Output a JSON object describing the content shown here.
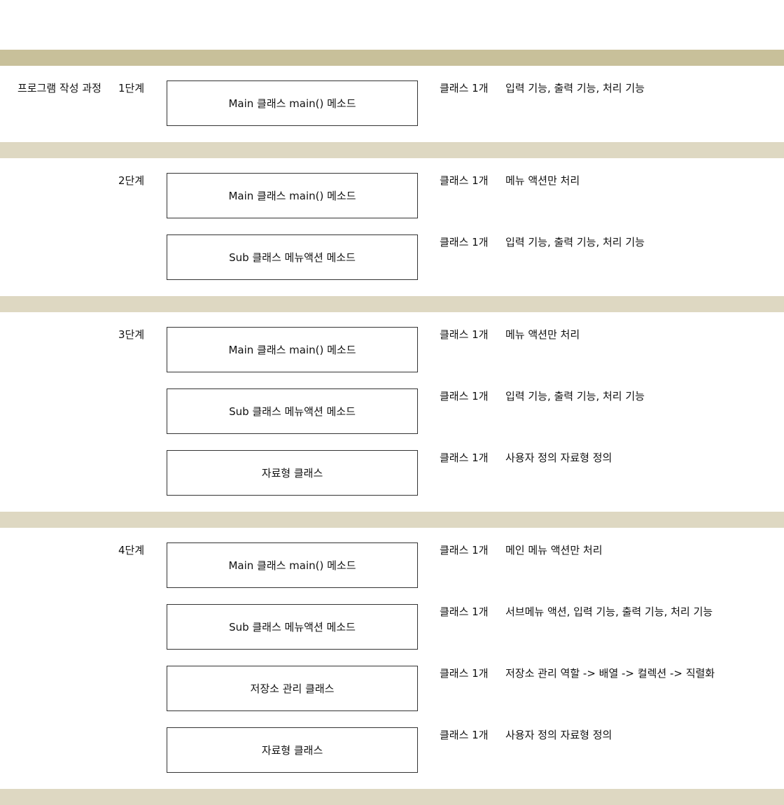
{
  "intro_label": "프로그램 작성 과정",
  "stages": [
    {
      "label": "1단계",
      "rows": [
        {
          "box": "Main 클래스 main() 메소드",
          "count": "클래스 1개",
          "desc": "입력 기능, 출력 기능, 처리 기능"
        }
      ]
    },
    {
      "label": "2단계",
      "rows": [
        {
          "box": "Main 클래스 main() 메소드",
          "count": "클래스 1개",
          "desc": "메뉴 액션만 처리"
        },
        {
          "box": "Sub 클래스 메뉴액션 메소드",
          "count": "클래스 1개",
          "desc": "입력 기능, 출력 기능, 처리 기능"
        }
      ]
    },
    {
      "label": "3단계",
      "rows": [
        {
          "box": "Main 클래스 main() 메소드",
          "count": "클래스 1개",
          "desc": "메뉴 액션만 처리"
        },
        {
          "box": "Sub 클래스 메뉴액션 메소드",
          "count": "클래스 1개",
          "desc": "입력 기능, 출력 기능, 처리 기능"
        },
        {
          "box": "자료형 클래스",
          "count": "클래스 1개",
          "desc": "사용자 정의 자료형 정의"
        }
      ]
    },
    {
      "label": "4단계",
      "rows": [
        {
          "box": "Main 클래스 main() 메소드",
          "count": "클래스 1개",
          "desc": "메인 메뉴 액션만 처리"
        },
        {
          "box": "Sub 클래스 메뉴액션 메소드",
          "count": "클래스 1개",
          "desc": "서브메뉴 액션, 입력 기능, 출력 기능, 처리 기능"
        },
        {
          "box": "저장소 관리 클래스",
          "count": "클래스 1개",
          "desc": "저장소 관리 역할 -> 배열 -> 컬렉션 -> 직렬화"
        },
        {
          "box": "자료형 클래스",
          "count": "클래스 1개",
          "desc": "사용자 정의 자료형 정의"
        }
      ]
    }
  ],
  "colors": {
    "band_dark": "#c8c09a",
    "band_light": "#ded8c2",
    "border": "#333333"
  }
}
